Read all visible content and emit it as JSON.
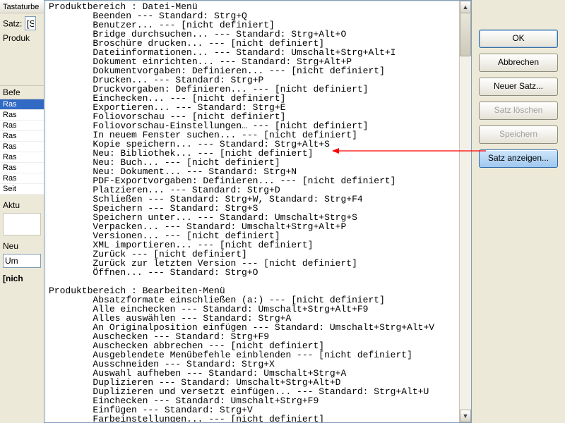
{
  "under_dialog": {
    "title": "Tastaturbe",
    "satz_label": "Satz:",
    "satz_value": "[S",
    "produkt_label": "Produk",
    "befehl_label": "Befe",
    "items": [
      "Ras",
      "Ras",
      "Ras",
      "Ras",
      "Ras",
      "Ras",
      "Ras",
      "Ras",
      "Seit"
    ],
    "aktu_label": "Aktu",
    "neu_label": "Neu",
    "combo_value": "Um",
    "nicht_label": "[nich"
  },
  "buttons": {
    "ok": "OK",
    "cancel": "Abbrechen",
    "new_set": "Neuer Satz...",
    "delete_set": "Satz löschen",
    "save": "Speichern",
    "show_set": "Satz anzeigen..."
  },
  "text": {
    "section1_title": "Produktbereich : Datei-Menü",
    "section1": [
      "Beenden --- Standard: Strg+Q",
      "Benutzer... --- [nicht definiert]",
      "Bridge durchsuchen... --- Standard: Strg+Alt+O",
      "Broschüre drucken... --- [nicht definiert]",
      "Dateiinformationen... --- Standard: Umschalt+Strg+Alt+I",
      "Dokument einrichten... --- Standard: Strg+Alt+P",
      "Dokumentvorgaben: Definieren... --- [nicht definiert]",
      "Drucken... --- Standard: Strg+P",
      "Druckvorgaben: Definieren... --- [nicht definiert]",
      "Einchecken... --- [nicht definiert]",
      "Exportieren... --- Standard: Strg+E",
      "Foliovorschau --- [nicht definiert]",
      "Foliovorschau-Einstellungen… --- [nicht definiert]",
      "In neuem Fenster suchen... --- [nicht definiert]",
      "Kopie speichern... --- Standard: Strg+Alt+S",
      "Neu: Bibliothek... --- [nicht definiert]",
      "Neu: Buch... --- [nicht definiert]",
      "Neu: Dokument... --- Standard: Strg+N",
      "PDF-Exportvorgaben: Definieren... --- [nicht definiert]",
      "Platzieren... --- Standard: Strg+D",
      "Schließen --- Standard: Strg+W, Standard: Strg+F4",
      "Speichern --- Standard: Strg+S",
      "Speichern unter... --- Standard: Umschalt+Strg+S",
      "Verpacken... --- Standard: Umschalt+Strg+Alt+P",
      "Versionen... --- [nicht definiert]",
      "XML importieren... --- [nicht definiert]",
      "Zurück --- [nicht definiert]",
      "Zurück zur letzten Version --- [nicht definiert]",
      "Öffnen... --- Standard: Strg+O"
    ],
    "section2_title": "Produktbereich : Bearbeiten-Menü",
    "section2": [
      "Absatzformate einschließen (a:) --- [nicht definiert]",
      "Alle einchecken --- Standard: Umschalt+Strg+Alt+F9",
      "Alles auswählen --- Standard: Strg+A",
      "An Originalposition einfügen --- Standard: Umschalt+Strg+Alt+V",
      "Auschecken --- Standard: Strg+F9",
      "Auschecken abbrechen --- [nicht definiert]",
      "Ausgeblendete Menübefehle einblenden --- [nicht definiert]",
      "Ausschneiden --- Standard: Strg+X",
      "Auswahl aufheben --- Standard: Umschalt+Strg+A",
      "Duplizieren --- Standard: Umschalt+Strg+Alt+D",
      "Duplizieren und versetzt einfügen... --- Standard: Strg+Alt+U",
      "Einchecken --- Standard: Umschalt+Strg+F9",
      "Einfügen --- Standard: Strg+V",
      "Farbeinstellungen... --- [nicht definiert]"
    ]
  }
}
